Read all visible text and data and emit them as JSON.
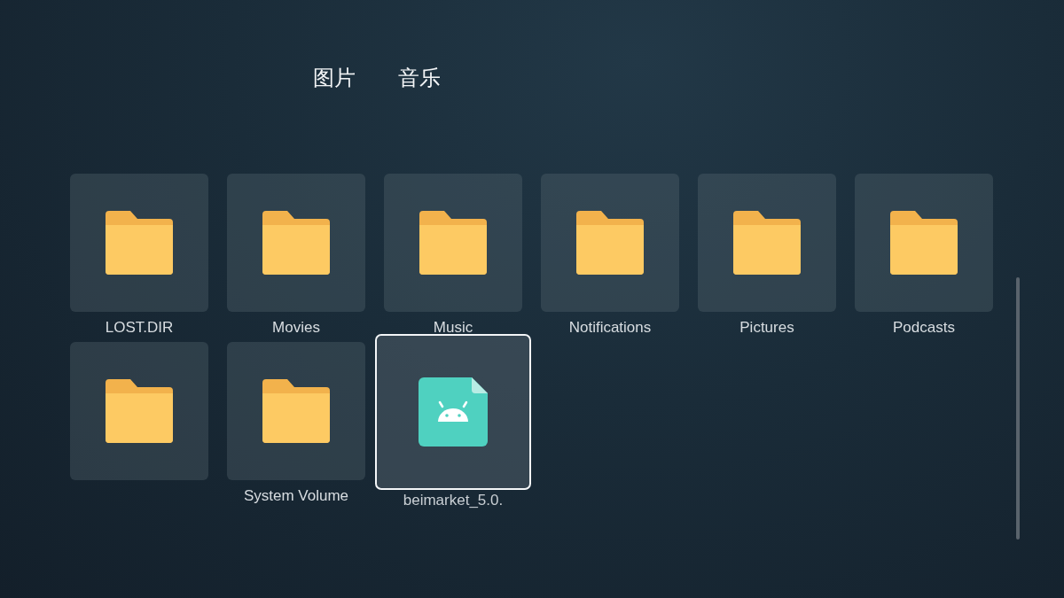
{
  "tabs": [
    {
      "label": "图片",
      "selected": false
    },
    {
      "label": "音乐",
      "selected": false
    }
  ],
  "items": [
    {
      "kind": "folder",
      "label": "LOST.DIR",
      "selected": false
    },
    {
      "kind": "folder",
      "label": "Movies",
      "selected": false
    },
    {
      "kind": "folder",
      "label": "Music",
      "selected": false
    },
    {
      "kind": "folder",
      "label": "Notifications",
      "selected": false
    },
    {
      "kind": "folder",
      "label": "Pictures",
      "selected": false
    },
    {
      "kind": "folder",
      "label": "Podcasts",
      "selected": false
    },
    {
      "kind": "folder",
      "selected": false
    },
    {
      "kind": "folder",
      "label": "System Volume",
      "selected": false
    },
    {
      "kind": "apk",
      "label": "beimarket_5.0.",
      "selected": true
    }
  ]
}
